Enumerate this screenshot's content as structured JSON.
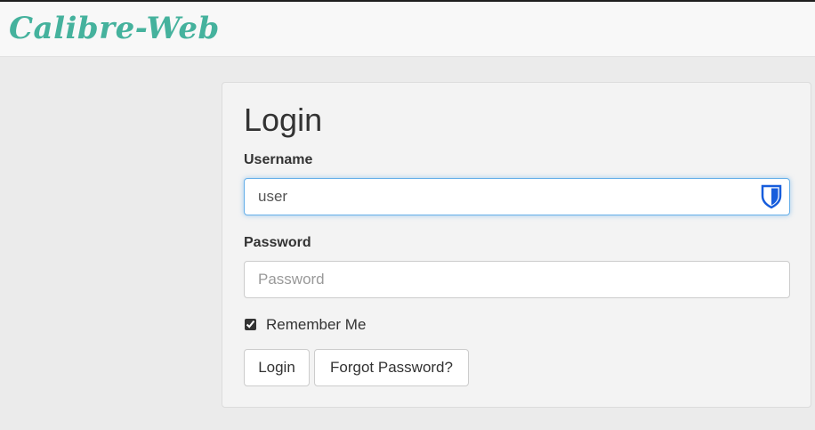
{
  "navbar": {
    "brand": "Calibre-Web"
  },
  "login": {
    "title": "Login",
    "username_label": "Username",
    "username_value": "user",
    "password_label": "Password",
    "password_placeholder": "Password",
    "remember_label": "Remember Me",
    "remember_checked": true,
    "login_button": "Login",
    "forgot_button": "Forgot Password?"
  },
  "colors": {
    "brand": "#45b29d",
    "highlight": "#f5f500",
    "shield": "#175ddc"
  },
  "icons": {
    "password_manager": "shield-icon",
    "checkbox": "checkbox-checked-icon"
  }
}
